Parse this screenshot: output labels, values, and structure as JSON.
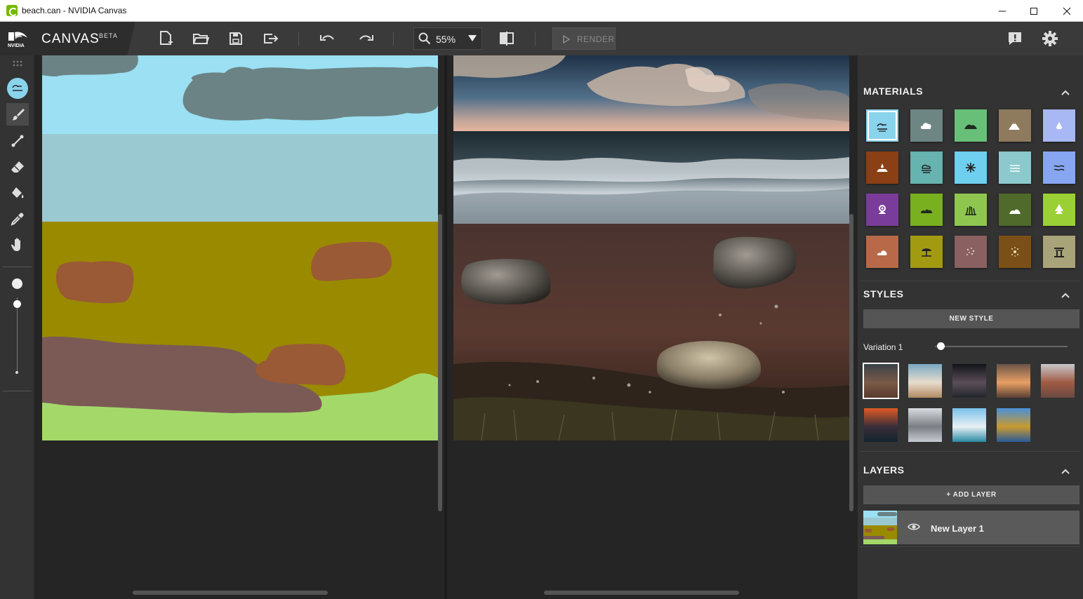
{
  "window": {
    "title": "beach.can - NVIDIA Canvas"
  },
  "brand": {
    "logo_text": "NVIDIA",
    "app_name": "CANVAS",
    "badge": "BETA"
  },
  "toolbar": {
    "zoom": "55%",
    "render_label": "RENDER",
    "icons": [
      "new-file-icon",
      "open-folder-icon",
      "save-icon",
      "export-icon",
      "undo-icon",
      "redo-icon",
      "search-icon",
      "dropdown-arrow-icon",
      "compare-icon",
      "alert-icon",
      "gear-icon"
    ]
  },
  "tools": [
    "grip-icon",
    "material-icon",
    "brush-icon",
    "line-icon",
    "eraser-icon",
    "fill-icon",
    "eyedropper-icon",
    "pan-hand-icon"
  ],
  "brush_size": {
    "level": 0.05
  },
  "materials": {
    "title": "MATERIALS",
    "items": [
      {
        "name": "sky",
        "color": "#8ad3ec",
        "icon": "sky"
      },
      {
        "name": "cloud",
        "color": "#6d8684",
        "icon": "cloud"
      },
      {
        "name": "hill",
        "color": "#68c078",
        "icon": "hill"
      },
      {
        "name": "mountain",
        "color": "#8e7b5e",
        "icon": "mountain"
      },
      {
        "name": "water-drop",
        "color": "#a8b8f4",
        "icon": "drop"
      },
      {
        "name": "mud",
        "color": "#8a3f14",
        "icon": "mud"
      },
      {
        "name": "fog",
        "color": "#66b3b0",
        "icon": "fog"
      },
      {
        "name": "snow",
        "color": "#6ecfee",
        "icon": "snow"
      },
      {
        "name": "sea",
        "color": "#8cc9cc",
        "icon": "sea"
      },
      {
        "name": "river",
        "color": "#87a6f2",
        "icon": "river"
      },
      {
        "name": "flower",
        "color": "#7a3c9a",
        "icon": "flower"
      },
      {
        "name": "bush",
        "color": "#78b020",
        "icon": "bush"
      },
      {
        "name": "grass",
        "color": "#8ec650",
        "icon": "grass"
      },
      {
        "name": "rock-hill",
        "color": "#4f6a2a",
        "icon": "rockhill"
      },
      {
        "name": "tree",
        "color": "#9ad035",
        "icon": "tree"
      },
      {
        "name": "stone",
        "color": "#b86a48",
        "icon": "stone"
      },
      {
        "name": "beach",
        "color": "#a29b12",
        "icon": "umbrella"
      },
      {
        "name": "gravel",
        "color": "#8a6060",
        "icon": "gravel"
      },
      {
        "name": "dirt",
        "color": "#7a5018",
        "icon": "dirt"
      },
      {
        "name": "building",
        "color": "#a9a37a",
        "icon": "building"
      }
    ]
  },
  "styles": {
    "title": "STYLES",
    "new_style_label": "NEW STYLE",
    "variation_label": "Variation 1",
    "variation_level": 0.03,
    "thumbs": [
      {
        "name": "desert-rocks",
        "top": "#3a4248",
        "mid": "#7a5a48",
        "bottom": "#5a3a2c"
      },
      {
        "name": "white-clouds",
        "top": "#7aa9c4",
        "mid": "#e8dccc",
        "bottom": "#b08a64"
      },
      {
        "name": "night-cave",
        "top": "#121418",
        "mid": "#5a4e58",
        "bottom": "#22262c"
      },
      {
        "name": "foggy-valley",
        "top": "#6a5448",
        "mid": "#e8a064",
        "bottom": "#5a4034"
      },
      {
        "name": "pink-mountain",
        "top": "#c8c8cc",
        "mid": "#a05a44",
        "bottom": "#6a4a42"
      },
      {
        "name": "sunset-sea",
        "top": "#e05a24",
        "mid": "#3a2e3a",
        "bottom": "#12242e"
      },
      {
        "name": "snowy-mountain",
        "top": "#d8dce0",
        "mid": "#7a7e84",
        "bottom": "#c8ccd2"
      },
      {
        "name": "tropical-coast",
        "top": "#7ac0e8",
        "mid": "#e8f0f4",
        "bottom": "#2a8aa4"
      },
      {
        "name": "lake-forest",
        "top": "#4a90d8",
        "mid": "#c89a30",
        "bottom": "#2a5a9a"
      }
    ]
  },
  "layers": {
    "title": "LAYERS",
    "add_label": "+ ADD LAYER",
    "items": [
      {
        "name": "New Layer 1"
      }
    ]
  }
}
